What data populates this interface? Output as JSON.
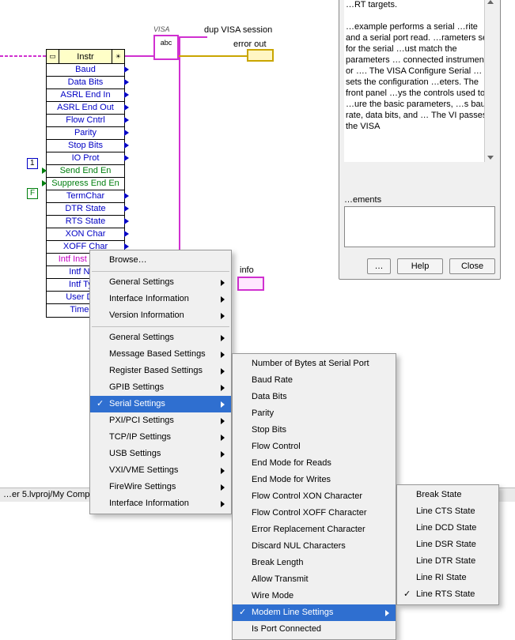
{
  "labels": {
    "dup": "dup VISA session",
    "errout": "error out",
    "visa_hdr": "VISA",
    "visa_abc": "abc",
    "instr": "Instr",
    "const1": "1",
    "constF": "F"
  },
  "prop_rows": [
    {
      "text": "Baud",
      "cls": "row-blue"
    },
    {
      "text": "Data Bits",
      "cls": "row-blue"
    },
    {
      "text": "ASRL End In",
      "cls": "row-blue"
    },
    {
      "text": "ASRL End Out",
      "cls": "row-blue"
    },
    {
      "text": "Flow Cntrl",
      "cls": "row-blue"
    },
    {
      "text": "Parity",
      "cls": "row-blue"
    },
    {
      "text": "Stop Bits",
      "cls": "row-blue"
    },
    {
      "text": "IO Prot",
      "cls": "row-blue"
    },
    {
      "text": "Send End En",
      "cls": "row-green"
    },
    {
      "text": "Suppress End En",
      "cls": "row-green"
    },
    {
      "text": "TermChar",
      "cls": "row-blue"
    },
    {
      "text": "DTR State",
      "cls": "row-blue"
    },
    {
      "text": "RTS State",
      "cls": "row-blue"
    },
    {
      "text": "XON Char",
      "cls": "row-blue"
    },
    {
      "text": "XOFF Char",
      "cls": "row-blue"
    },
    {
      "text": "Intf Inst Name",
      "cls": "row-magenta"
    },
    {
      "text": "Intf Num",
      "cls": "row-blue"
    },
    {
      "text": "Intf Type",
      "cls": "row-blue"
    },
    {
      "text": "User Data",
      "cls": "row-blue"
    },
    {
      "text": "Timeout",
      "cls": "row-blue"
    }
  ],
  "help": {
    "text": "…RT targets.\n\n…example performs a serial …rite and a serial port read. …rameters set for the serial …ust match the parameters … connected instrument or …. The VISA Configure Serial … sets the configuration …eters. The front panel …ys the controls used to …ure the basic parameters, …s baud rate, data bits, and … The VI passes the VISA",
    "req_label": "…ements",
    "btn_more": "…",
    "btn_help": "Help",
    "btn_close": "Close"
  },
  "menu1": [
    {
      "text": "Browse…",
      "sub": false
    },
    {
      "sep": true
    },
    {
      "text": "General Settings",
      "sub": true
    },
    {
      "text": "Interface Information",
      "sub": true
    },
    {
      "text": "Version Information",
      "sub": true
    },
    {
      "sep": true
    },
    {
      "text": "General Settings",
      "sub": true
    },
    {
      "text": "Message Based Settings",
      "sub": true
    },
    {
      "text": "Register Based Settings",
      "sub": true
    },
    {
      "text": "GPIB Settings",
      "sub": true
    },
    {
      "text": "Serial Settings",
      "sub": true,
      "sel": true,
      "check": true
    },
    {
      "text": "PXI/PCI Settings",
      "sub": true
    },
    {
      "text": "TCP/IP Settings",
      "sub": true
    },
    {
      "text": "USB Settings",
      "sub": true
    },
    {
      "text": "VXI/VME Settings",
      "sub": true
    },
    {
      "text": "FireWire Settings",
      "sub": true
    },
    {
      "text": "Interface Information",
      "sub": true
    }
  ],
  "menu2": [
    {
      "text": "Number of Bytes at Serial Port"
    },
    {
      "text": "Baud Rate"
    },
    {
      "text": "Data Bits"
    },
    {
      "text": "Parity"
    },
    {
      "text": "Stop Bits"
    },
    {
      "text": "Flow Control"
    },
    {
      "text": "End Mode for Reads"
    },
    {
      "text": "End Mode for Writes"
    },
    {
      "text": "Flow Control XON Character"
    },
    {
      "text": "Flow Control XOFF Character"
    },
    {
      "text": "Error Replacement Character"
    },
    {
      "text": "Discard NUL Characters"
    },
    {
      "text": "Break Length"
    },
    {
      "text": "Allow Transmit"
    },
    {
      "text": "Wire Mode"
    },
    {
      "text": "Modem Line Settings",
      "sub": true,
      "sel": true,
      "check": true
    },
    {
      "text": "Is Port Connected"
    }
  ],
  "menu3": [
    {
      "text": "Break State"
    },
    {
      "text": "Line CTS State"
    },
    {
      "text": "Line DCD State"
    },
    {
      "text": "Line DSR State"
    },
    {
      "text": "Line DTR State"
    },
    {
      "text": "Line RI State"
    },
    {
      "text": "Line RTS State",
      "check": true
    }
  ],
  "info_label": "info",
  "status": "…er 5.lvproj/My Comp…"
}
